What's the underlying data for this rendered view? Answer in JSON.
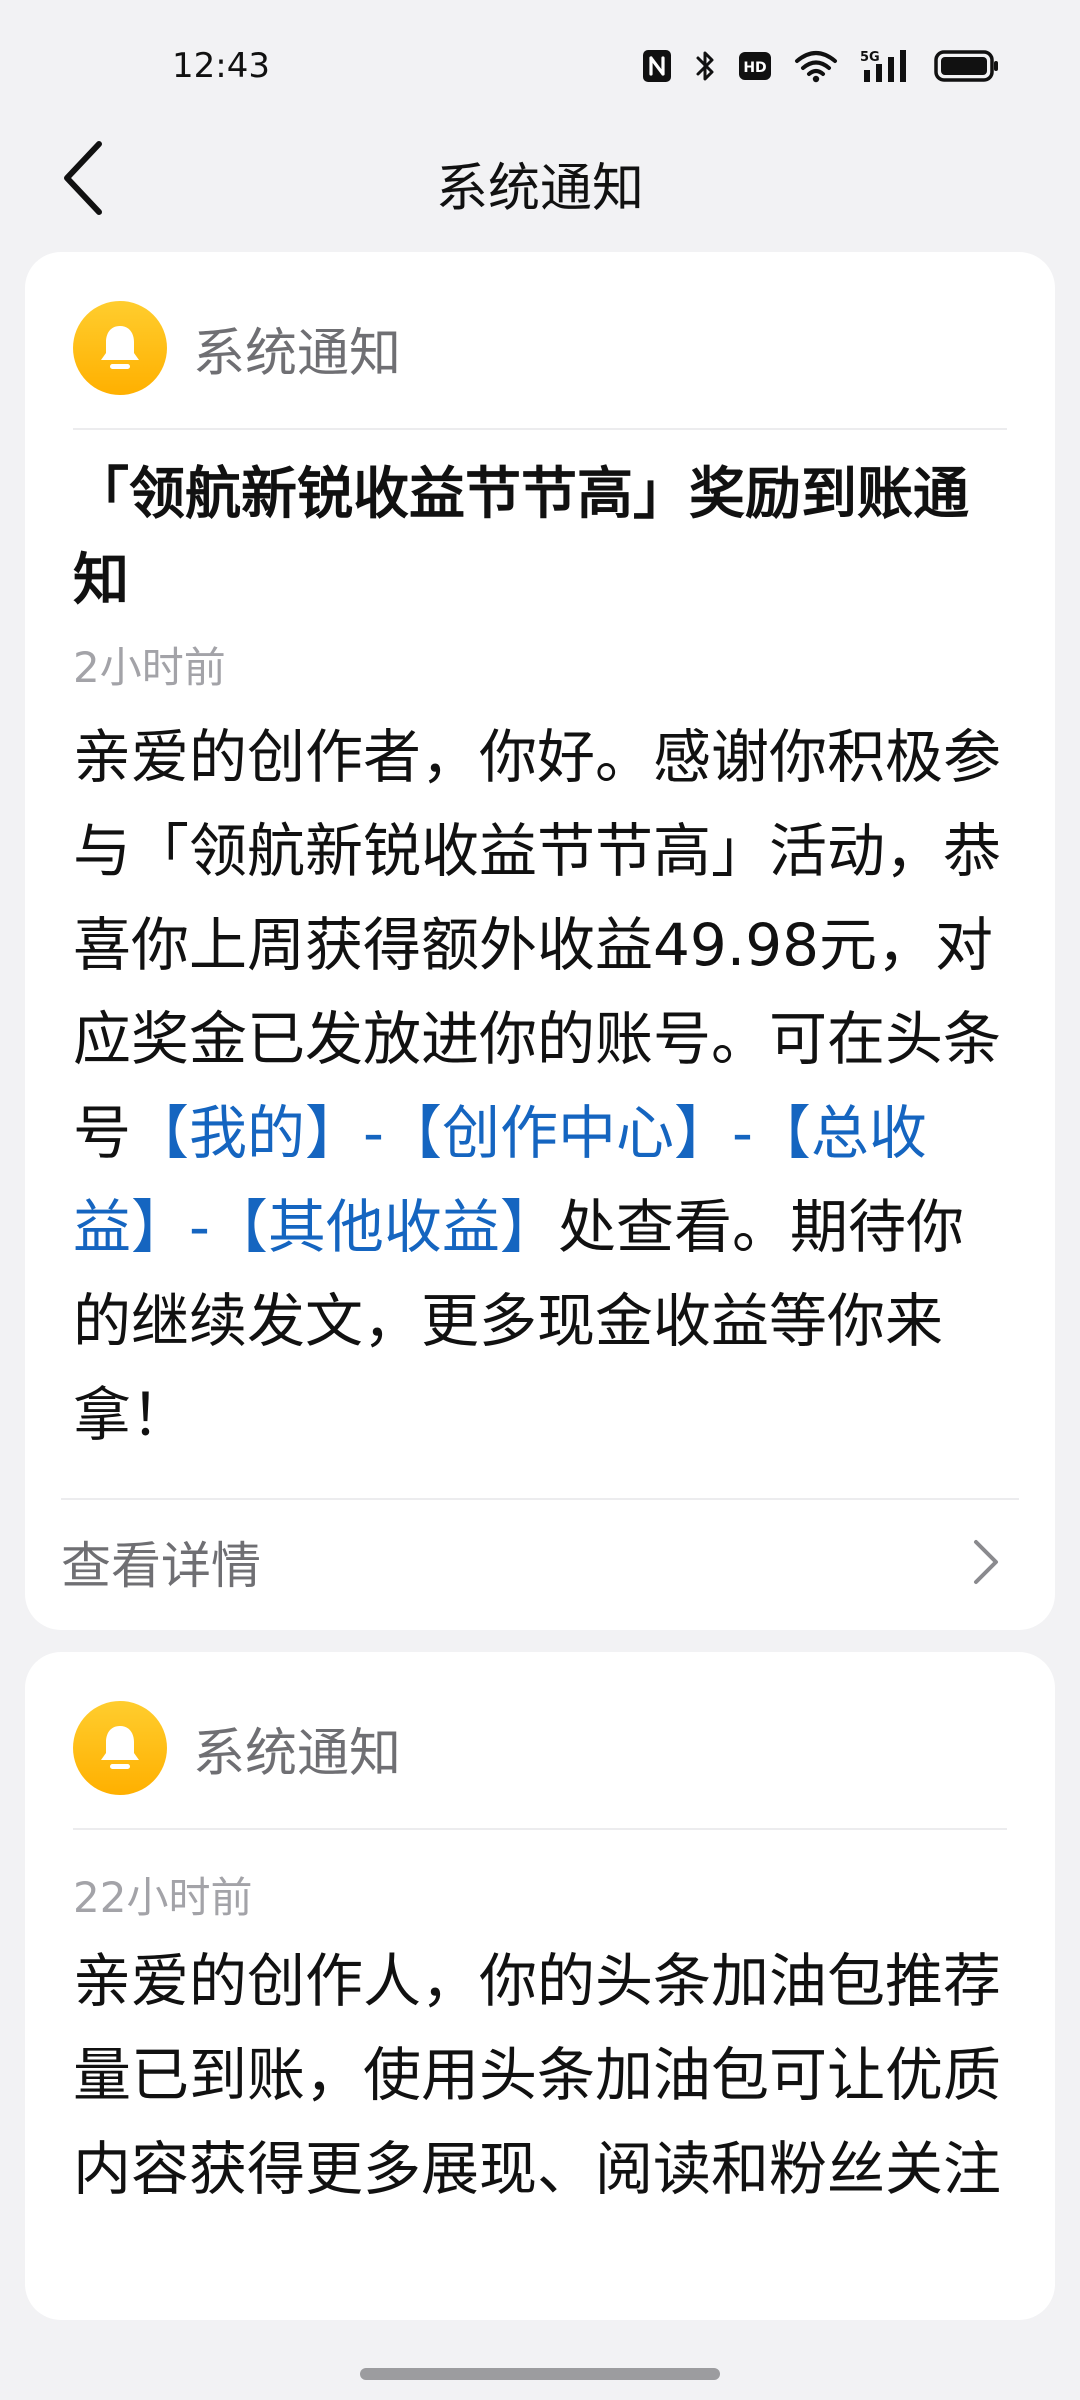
{
  "status_bar": {
    "time": "12:43",
    "icons": [
      "nfc-icon",
      "bluetooth-icon",
      "hd-icon",
      "wifi-icon",
      "5g-signal-icon",
      "battery-icon"
    ],
    "hd_label": "HD",
    "network_label": "5G"
  },
  "nav": {
    "title": "系统通知"
  },
  "cards": [
    {
      "header_label": "系统通知",
      "title": "「领航新锐收益节节高」奖励到账通知",
      "time": "2小时前",
      "body_parts": [
        {
          "text": "亲爱的创作者，你好。感谢你积极参与「领航新锐收益节节高」活动，恭喜你上周获得额外收益49.98元，对应奖金已发放进你的账号。可在头条号",
          "link": false
        },
        {
          "text": "【我的】-【创作中心】-【总收益】-【其他收益】",
          "link": true
        },
        {
          "text": "处查看。期待你的继续发文，更多现金收益等你来拿！",
          "link": false
        }
      ],
      "details_label": "查看详情"
    },
    {
      "header_label": "系统通知",
      "time": "22小时前",
      "body": "亲爱的创作人，你的头条加油包推荐量已到账，使用头条加油包可让优质内容获得更多展现、阅读和粉丝关注"
    }
  ],
  "colors": {
    "background": "#f2f2f4",
    "card": "#ffffff",
    "bell": "#ffbf1f",
    "link": "#1565c0",
    "secondary_text": "#6f6f73",
    "time_text": "#a3a3a8"
  }
}
